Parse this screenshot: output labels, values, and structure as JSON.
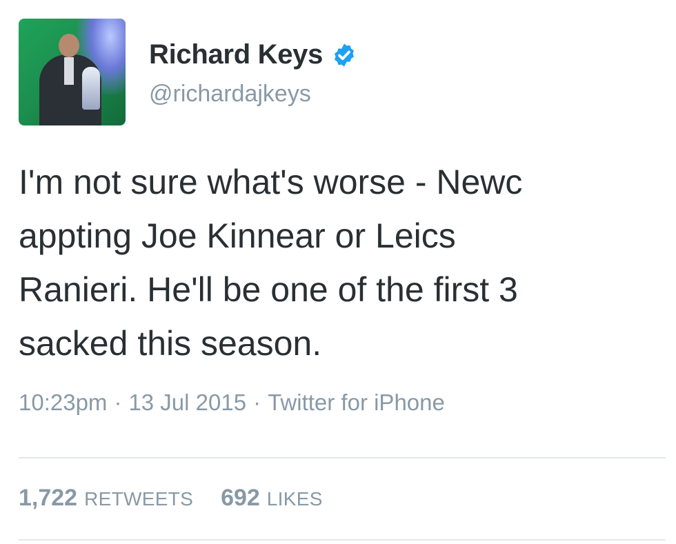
{
  "tweet": {
    "author": {
      "name": "Richard Keys",
      "handle": "@richardajkeys",
      "verified": true
    },
    "text": "I'm not sure what's worse - Newc\nappting Joe Kinnear or Leics\nRanieri. He'll be one of the first 3\nsacked this season.",
    "time": "10:23pm",
    "date": "13 Jul 2015",
    "source": "Twitter for iPhone",
    "separator": "·",
    "stats": {
      "retweets_count": "1,722",
      "retweets_label": "RETWEETS",
      "likes_count": "692",
      "likes_label": "LIKES"
    }
  },
  "colors": {
    "text": "#292f33",
    "muted": "#8899a6",
    "verified_blue": "#1da1f2",
    "divider": "#e1e8ed"
  },
  "icons": {
    "verified": "verified-badge-icon"
  }
}
